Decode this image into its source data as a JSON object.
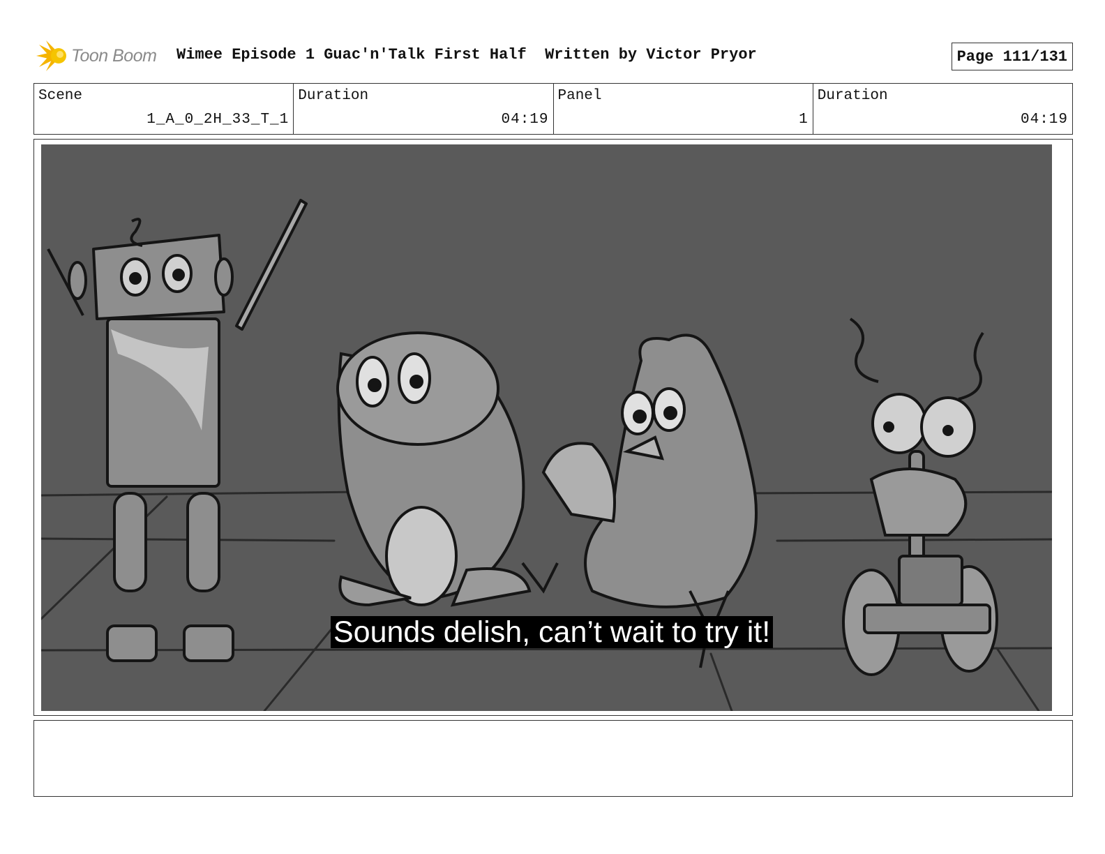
{
  "header": {
    "logo_text": "Toon Boom",
    "title": "Wimee Episode 1 Guac'n'Talk First Half  Written by Victor Pryor",
    "page": "Page 111/131"
  },
  "info": {
    "scene_label": "Scene",
    "scene_value": "1_A_0_2H_33_T_1",
    "duration_label": "Duration",
    "duration_value": "04:19",
    "panel_label": "Panel",
    "panel_value": "1",
    "panel_duration_label": "Duration",
    "panel_duration_value": "04:19"
  },
  "panel": {
    "subtitle": "Sounds delish, can’t wait to try it!"
  },
  "notes": {
    "text": ""
  }
}
